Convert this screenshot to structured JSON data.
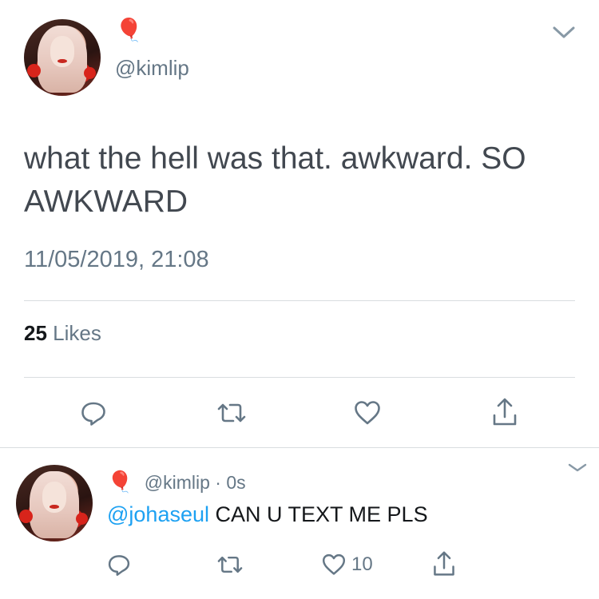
{
  "main_tweet": {
    "balloon": "🎈",
    "handle": "@kimlip",
    "text_line1": "what the hell was that. awkward. SO",
    "text_line2": "AWKWARD",
    "timestamp": "11/05/2019, 21:08",
    "likes_count": "25",
    "likes_label": "Likes"
  },
  "reply_tweet": {
    "balloon": "🎈",
    "handle": "@kimlip",
    "separator": "·",
    "time": "0s",
    "mention": "@johaseul",
    "text": "CAN U TEXT ME PLS",
    "like_count": "10"
  },
  "icons": {
    "colors": {
      "icon": "#657786",
      "link": "#1da1f2",
      "divider": "#d9dde0"
    }
  }
}
